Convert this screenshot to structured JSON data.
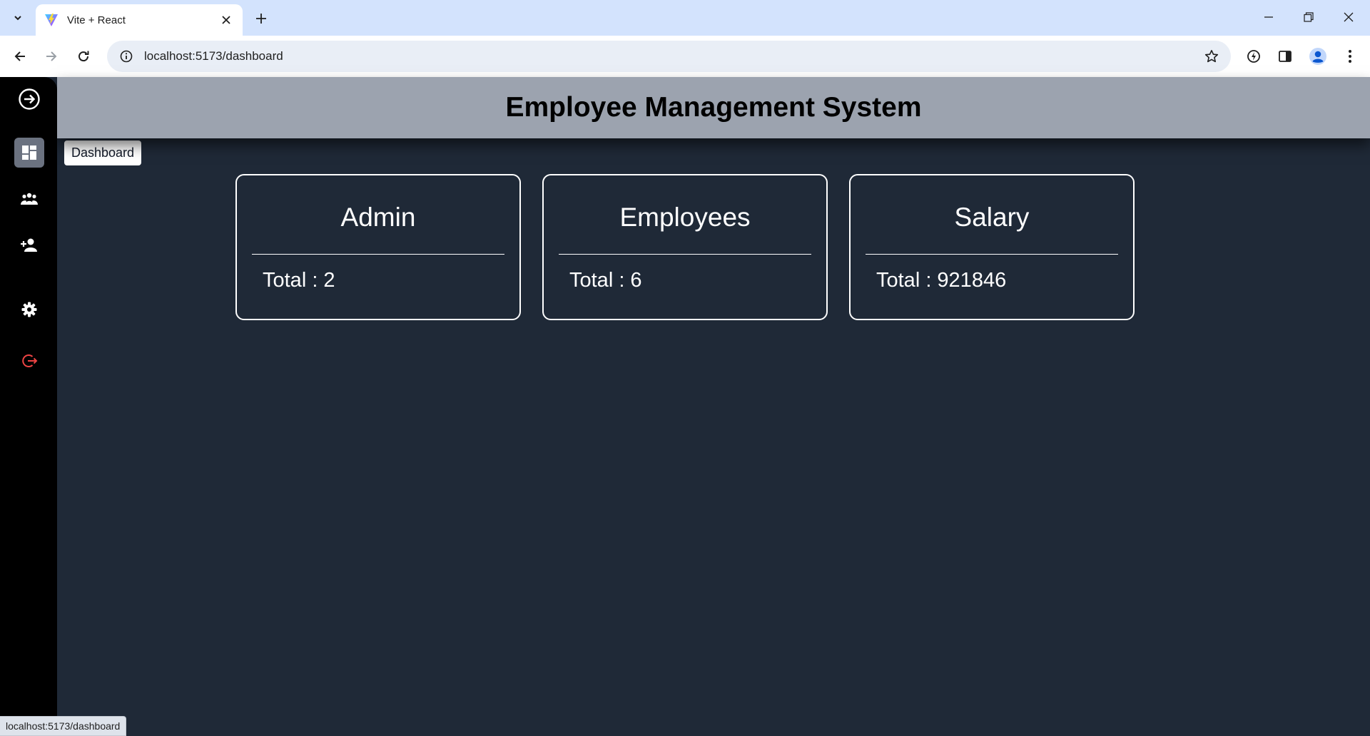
{
  "browser": {
    "tab_title": "Vite + React",
    "url": "localhost:5173/dashboard",
    "status_url": "localhost:5173/dashboard"
  },
  "sidebar": {
    "tooltip": "Dashboard",
    "items": [
      {
        "icon": "arrow-circle-right-icon"
      },
      {
        "icon": "dashboard-icon"
      },
      {
        "icon": "people-icon"
      },
      {
        "icon": "person-add-icon"
      },
      {
        "icon": "gear-icon"
      },
      {
        "icon": "logout-icon"
      }
    ]
  },
  "header": {
    "title": "Employee Management System"
  },
  "cards": [
    {
      "title": "Admin",
      "total": "Total : 2"
    },
    {
      "title": "Employees",
      "total": "Total : 6"
    },
    {
      "title": "Salary",
      "total": "Total : 921846"
    }
  ],
  "colors": {
    "page_bg": "#1f2937",
    "sidebar_bg": "#000000",
    "header_bg": "#9ca3af",
    "logout_red": "#ef4444"
  }
}
